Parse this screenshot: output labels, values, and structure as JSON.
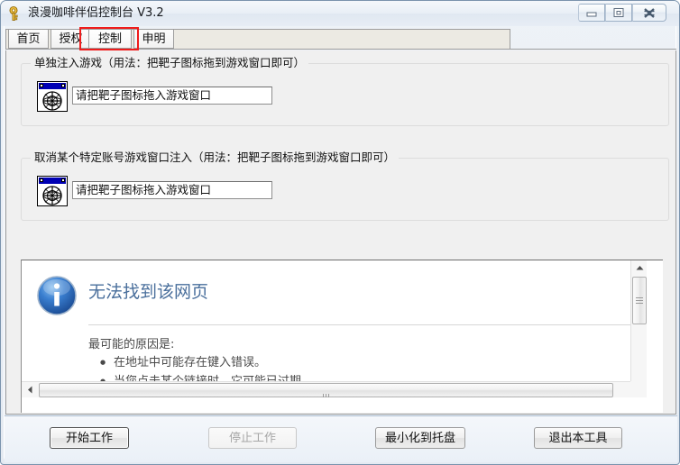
{
  "window": {
    "title": "浪漫咖啡伴侣控制台 V3.2",
    "icon": "key-icon",
    "controls": {
      "minimize": "minimize-icon",
      "maximize": "maximize-icon",
      "close": "close-icon"
    }
  },
  "tabs": [
    {
      "label": "首页",
      "selected": false
    },
    {
      "label": "授权",
      "selected": false
    },
    {
      "label": "控制",
      "selected": true
    },
    {
      "label": "申明",
      "selected": false
    }
  ],
  "annotation": {
    "type": "red-rectangle",
    "color": "#ef1c1c",
    "targets_tab": "控制"
  },
  "groups": [
    {
      "legend": "单独注入游戏（用法：把靶子图标拖到游戏窗口即可）",
      "target_icon": "target-crosshair-icon",
      "field_value": "请把靶子图标拖入游戏窗口"
    },
    {
      "legend": "取消某个特定账号游戏窗口注入（用法：把靶子图标拖到游戏窗口即可）",
      "target_icon": "target-crosshair-icon",
      "field_value": "请把靶子图标拖入游戏窗口"
    }
  ],
  "browser": {
    "error_icon": "info-icon",
    "title": "无法找到该网页",
    "reason_heading": "最可能的原因是:",
    "reasons": [
      "在地址中可能存在键入错误。",
      "当您点击某个链接时，它可能已过期。"
    ],
    "scrollbars": {
      "vertical": {
        "up": "scroll-up-arrow",
        "down": "scroll-down-arrow"
      },
      "horizontal": {
        "left": "scroll-left-arrow",
        "right": "scroll-right-arrow"
      }
    }
  },
  "footer": {
    "buttons": [
      {
        "label": "开始工作",
        "state": "focused"
      },
      {
        "label": "停止工作",
        "state": "disabled"
      },
      {
        "label": "最小化到托盘",
        "state": "normal"
      },
      {
        "label": "退出本工具",
        "state": "normal"
      }
    ]
  },
  "colors": {
    "accent": "#4a6f9c",
    "annotation": "#ef1c1c",
    "titlebar_icon": "#f0c419",
    "target_titlebar": "#0000b4"
  }
}
